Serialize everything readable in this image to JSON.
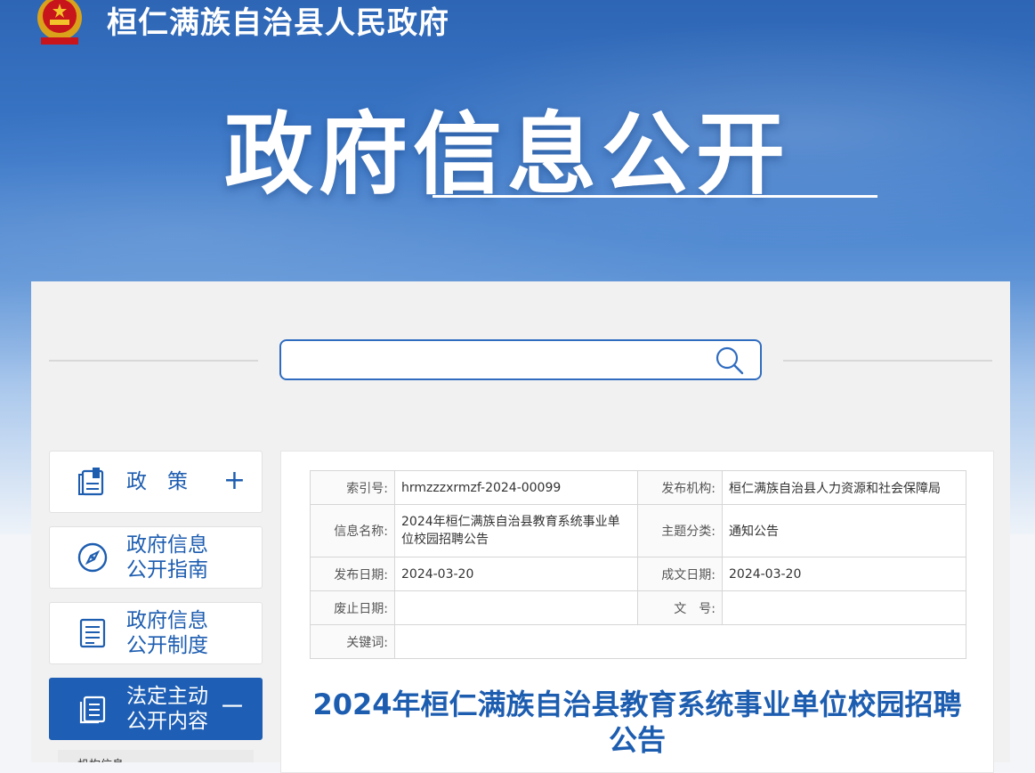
{
  "header": {
    "site_name": "桓仁满族自治县人民政府",
    "section_title": "政府信息公开"
  },
  "search": {
    "placeholder": "",
    "value": ""
  },
  "sidebar": {
    "items": [
      {
        "label_line1": "政　策",
        "label_line2": "",
        "toggle": "+",
        "icon": "book-icon"
      },
      {
        "label_line1": "政府信息",
        "label_line2": "公开指南",
        "icon": "compass-icon"
      },
      {
        "label_line1": "政府信息",
        "label_line2": "公开制度",
        "icon": "list-doc-icon"
      },
      {
        "label_line1": "法定主动",
        "label_line2": "公开内容",
        "toggle": "－",
        "icon": "files-icon",
        "active": true
      }
    ],
    "sub_item": "机构信息"
  },
  "meta": {
    "index_label": "索引号:",
    "index_value": "hrmzzzxrmzf-2024-00099",
    "publisher_label": "发布机构:",
    "publisher_value": "桓仁满族自治县人力资源和社会保障局",
    "name_label": "信息名称:",
    "name_value": "2024年桓仁满族自治县教育系统事业单位校园招聘公告",
    "topic_label": "主题分类:",
    "topic_value": "通知公告",
    "publish_date_label": "发布日期:",
    "publish_date_value": "2024-03-20",
    "written_date_label": "成文日期:",
    "written_date_value": "2024-03-20",
    "expire_label": "废止日期:",
    "expire_value": "",
    "doc_no_label": "文　号:",
    "doc_no_value": "",
    "keywords_label": "关键词:",
    "keywords_value": ""
  },
  "document": {
    "title": "2024年桓仁满族自治县教育系统事业单位校园招聘公告"
  },
  "colors": {
    "accent": "#1e5fb5",
    "banner_top": "#2e66b5"
  }
}
